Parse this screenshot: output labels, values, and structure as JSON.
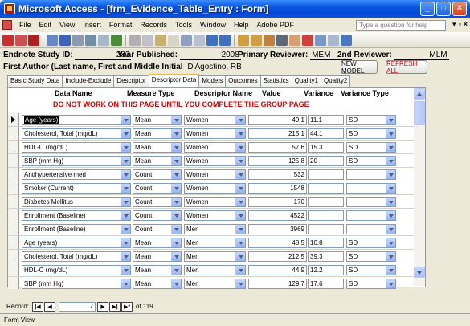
{
  "window": {
    "title": "Microsoft Access - [frm_Evidence_Table_Entry : Form]"
  },
  "menu": {
    "items": [
      "File",
      "Edit",
      "View",
      "Insert",
      "Format",
      "Records",
      "Tools",
      "Window",
      "Help",
      "Adobe PDF"
    ],
    "help_placeholder": "Type a question for help"
  },
  "header": {
    "endnote_label": "Endnote Study ID:",
    "endnote_value": "283",
    "year_label": "Year Published:",
    "year_value": "2008",
    "primary_reviewer_label": "Primary Reviewer:",
    "primary_reviewer_value": "MEM",
    "second_reviewer_label": "2nd Reviewer:",
    "second_reviewer_value": "MLM",
    "first_author_label": "First Author (Last name, First and Middle Initial",
    "first_author_value": "D'Agostino, RB",
    "new_model_button": "NEW MODEL",
    "refresh_all_button": "REFRESH ALL"
  },
  "tabs": [
    "Basic Study Data",
    "Include-Exclude",
    "Descriptor",
    "Descriptor Data",
    "Models",
    "Outcomes",
    "Statistics",
    "Quality1",
    "Quality2"
  ],
  "active_tab": "Descriptor Data",
  "columns": {
    "data_name": "Data Name",
    "measure_type": "Measure Type",
    "descriptor_name": "Descriptor Name",
    "value": "Value",
    "variance": "Variance",
    "variance_type": "Variance Type"
  },
  "warning": "DO NOT WORK ON THIS PAGE UNTIL YOU COMPLETE THE GROUP PAGE",
  "rows": [
    {
      "data_name": "Age (years)",
      "measure": "Mean",
      "descriptor": "Women",
      "value": "49.1",
      "variance": "11.1",
      "variance_type": "SD"
    },
    {
      "data_name": "Cholesterol, Total (mg/dL)",
      "measure": "Mean",
      "descriptor": "Women",
      "value": "215.1",
      "variance": "44.1",
      "variance_type": "SD"
    },
    {
      "data_name": "HDL-C (mg/dL)",
      "measure": "Mean",
      "descriptor": "Women",
      "value": "57.6",
      "variance": "15.3",
      "variance_type": "SD"
    },
    {
      "data_name": "SBP (mm Hg)",
      "measure": "Mean",
      "descriptor": "Women",
      "value": "125.8",
      "variance": "20",
      "variance_type": "SD"
    },
    {
      "data_name": "Antihypertensive med",
      "measure": "Count",
      "descriptor": "Women",
      "value": "532",
      "variance": "",
      "variance_type": ""
    },
    {
      "data_name": "Smoker (Current)",
      "measure": "Count",
      "descriptor": "Women",
      "value": "1548",
      "variance": "",
      "variance_type": ""
    },
    {
      "data_name": "Diabetes Mellitus",
      "measure": "Count",
      "descriptor": "Women",
      "value": "170",
      "variance": "",
      "variance_type": ""
    },
    {
      "data_name": "Enrollment (Baseline)",
      "measure": "Count",
      "descriptor": "Women",
      "value": "4522",
      "variance": "",
      "variance_type": ""
    },
    {
      "data_name": "Enrollment (Baseline)",
      "measure": "Count",
      "descriptor": "Men",
      "value": "3969",
      "variance": "",
      "variance_type": ""
    },
    {
      "data_name": "Age (years)",
      "measure": "Mean",
      "descriptor": "Men",
      "value": "48.5",
      "variance": "10.8",
      "variance_type": "SD"
    },
    {
      "data_name": "Cholesterol, Total (mg/dL)",
      "measure": "Mean",
      "descriptor": "Men",
      "value": "212.5",
      "variance": "39.3",
      "variance_type": "SD"
    },
    {
      "data_name": "HDL-C (mg/dL)",
      "measure": "Mean",
      "descriptor": "Men",
      "value": "44.9",
      "variance": "12.2",
      "variance_type": "SD"
    },
    {
      "data_name": "SBP (mm Hg)",
      "measure": "Mean",
      "descriptor": "Men",
      "value": "129.7",
      "variance": "17.6",
      "variance_type": "SD"
    }
  ],
  "record_nav": {
    "label": "Record:",
    "current": "7",
    "of_label": "of 119"
  },
  "status": "Form View"
}
